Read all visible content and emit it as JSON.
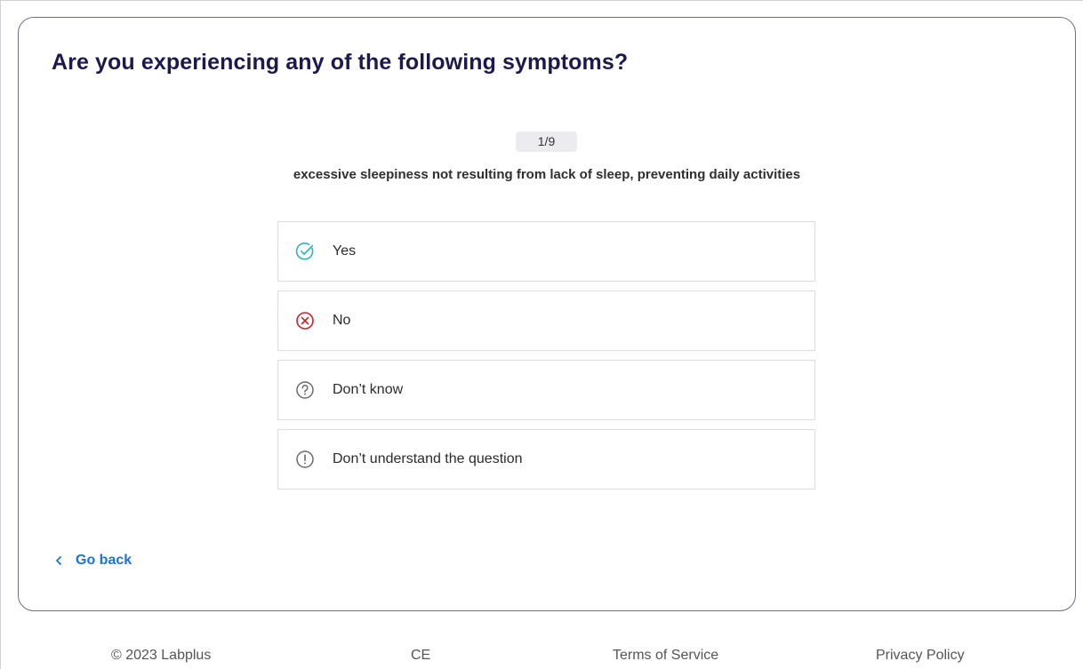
{
  "title": "Are you experiencing any of the following symptoms?",
  "progress": {
    "label": "1/9",
    "current": 1,
    "total": 9
  },
  "question": "excessive sleepiness not resulting from lack of sleep, preventing daily activities",
  "options": [
    {
      "label": "Yes",
      "icon": "check-circle-icon",
      "color": "#2bb5c0"
    },
    {
      "label": "No",
      "icon": "x-circle-icon",
      "color": "#c4262e"
    },
    {
      "label": "Don’t know",
      "icon": "question-circle-icon",
      "color": "#6b6b6b"
    },
    {
      "label": "Don’t understand the question",
      "icon": "exclamation-circle-icon",
      "color": "#6b6b6b"
    }
  ],
  "nav": {
    "back_label": "Go back"
  },
  "footer": {
    "copyright": "© 2023 Labplus",
    "ce": "CE",
    "terms": "Terms of Service",
    "privacy": "Privacy Policy"
  },
  "colors": {
    "title": "#1c1a4d",
    "link": "#1f73c9",
    "card_border": "#6e6e8c"
  }
}
